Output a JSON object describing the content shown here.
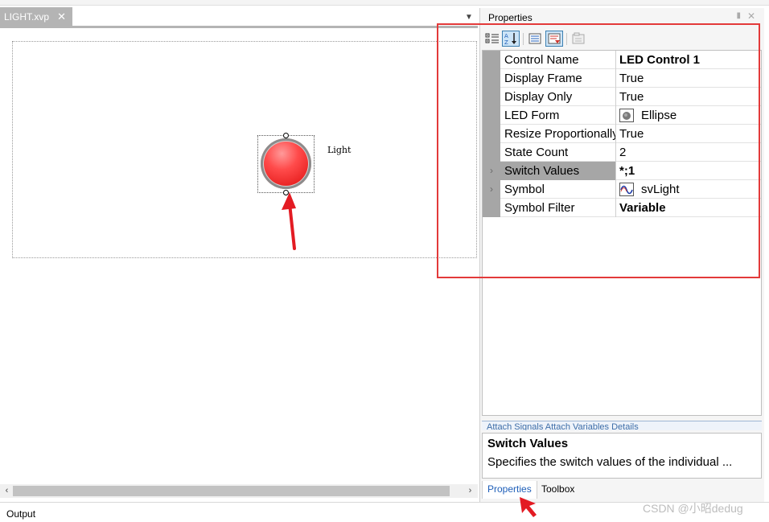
{
  "document_tab": {
    "label": "LIGHT.xvp",
    "close_glyph": "✕",
    "dropdown_glyph": "▼"
  },
  "canvas": {
    "led_label": "Light",
    "led_color": "#ff3b3b",
    "annotation_color": "#e31b23"
  },
  "scrollbar": {
    "left_glyph": "‹",
    "right_glyph": "›"
  },
  "properties": {
    "title": "Properties",
    "pin_glyph": "▮",
    "close_glyph": "✕",
    "rows": [
      {
        "name": "Control Name",
        "value": "LED Control 1",
        "bold": true
      },
      {
        "name": "Display Frame",
        "value": "True"
      },
      {
        "name": "Display Only",
        "value": "True"
      },
      {
        "name": "LED Form",
        "value": "Ellipse",
        "icon": "ellipse-icon"
      },
      {
        "name": "Resize Proportionally",
        "value": "True"
      },
      {
        "name": "State Count",
        "value": "2"
      },
      {
        "name": "Switch Values",
        "value": "*;1",
        "bold": true,
        "expandable": true,
        "selected": true
      },
      {
        "name": "Symbol",
        "value": "svLight",
        "expandable": true,
        "icon": "symbol-wave-icon"
      },
      {
        "name": "Symbol Filter",
        "value": "Variable",
        "bold": true
      }
    ],
    "expand_glyph": "›",
    "tabs_strip_text": "Attach Signals   Attach Variables   Details",
    "description": {
      "title": "Switch Values",
      "text": "Specifies the switch values of the individual ..."
    },
    "bottom_tabs": [
      "Properties",
      "Toolbox"
    ],
    "highlight_color": "#e33a3a"
  },
  "output": {
    "label": "Output"
  },
  "watermark": "CSDN @小昭dedug"
}
